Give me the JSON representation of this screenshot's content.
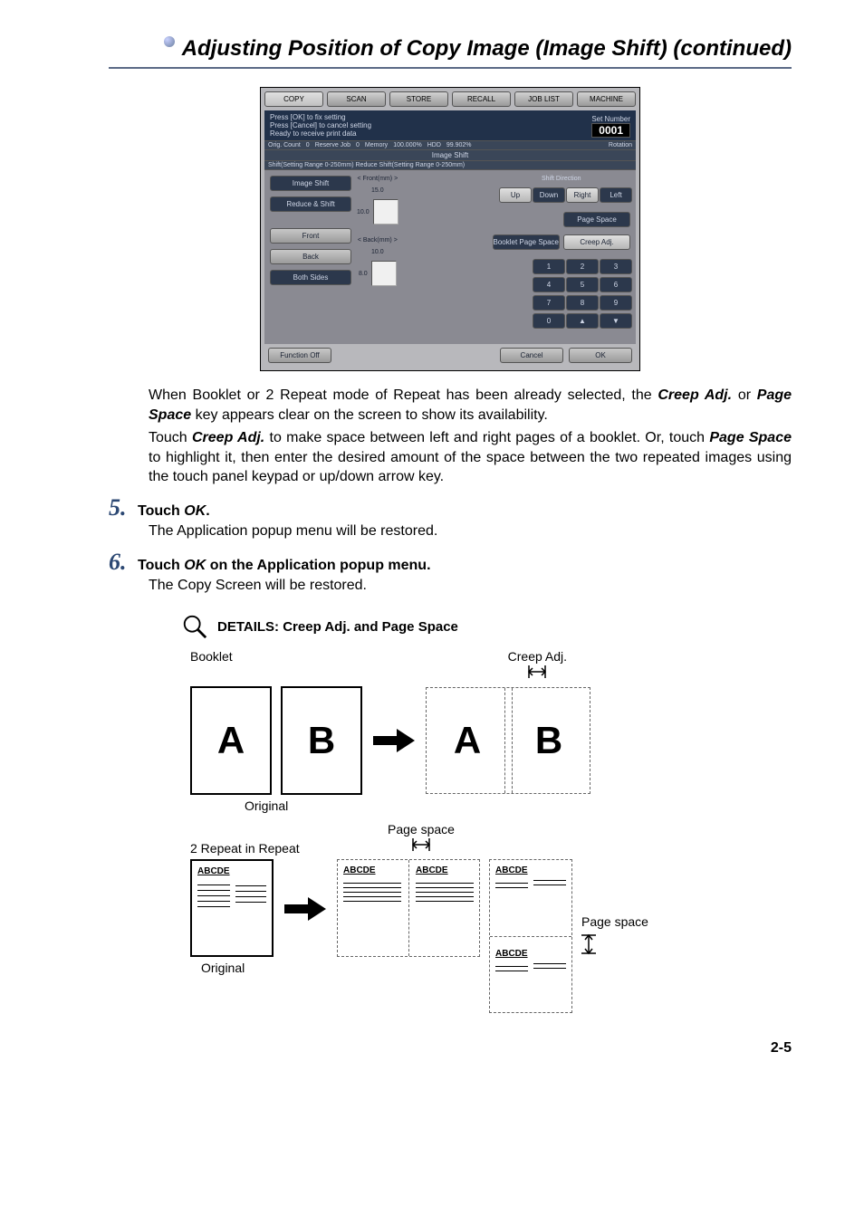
{
  "title": "Adjusting Position of Copy Image (Image Shift) (continued)",
  "panel": {
    "tabs": [
      "COPY",
      "SCAN",
      "STORE",
      "RECALL",
      "JOB LIST",
      "MACHINE"
    ],
    "msg1": "Press [OK] to fix setting",
    "msg2": "Press [Cancel] to cancel setting",
    "msg3": "Ready to receive print data",
    "setnum_label": "Set Number",
    "setnum_value": "0001",
    "status": {
      "orig_count": "Orig. Count",
      "orig_val": "0",
      "reserve": "Reserve Job",
      "reserve_val": "0",
      "memory": "Memory",
      "memory_val": "100.000%",
      "hdd": "HDD",
      "hdd_val": "99.902%",
      "rotation": "Rotation"
    },
    "heading": "Image Shift",
    "subheading": "Shift(Setting Range 0-250mm)  Reduce Shift(Setting Range 0-250mm)",
    "left_buttons": {
      "image_shift": "Image Shift",
      "reduce_shift": "Reduce & Shift",
      "front": "Front",
      "back": "Back",
      "both_sides": "Both Sides"
    },
    "center": {
      "front_label": "< Front(mm) >",
      "front_top": "15.0",
      "front_left": "10.0",
      "back_label": "< Back(mm) >",
      "back_top": "10.0",
      "back_left": "8.0"
    },
    "right": {
      "shift_dir": "Shift Direction",
      "dirs": [
        "Up",
        "Down",
        "Right",
        "Left"
      ],
      "page_space": "Page Space",
      "booklet_ps": "Booklet Page Space",
      "creep_adj": "Creep Adj.",
      "numpad": [
        "1",
        "2",
        "3",
        "4",
        "5",
        "6",
        "7",
        "8",
        "9",
        "0",
        "▲",
        "▼"
      ]
    },
    "function_off": "Function Off",
    "cancel": "Cancel",
    "ok": "OK"
  },
  "para1_prefix": "When Booklet or 2 Repeat mode of Repeat has been already selected, the ",
  "para1_creep": "Creep Adj.",
  "para1_or": " or ",
  "para1_ps": "Page Space",
  "para1_suffix": " key appears clear on the screen to show its availability.",
  "para2_prefix": "Touch ",
  "para2_creep": "Creep Adj.",
  "para2_mid": " to make space between left and right pages of a booklet. Or, touch ",
  "para2_ps": "Page Space",
  "para2_suffix": " to highlight it, then enter the desired amount of the space between the two repeated images using the touch panel keypad or up/down arrow key.",
  "step5_num": "5.",
  "step5_head_a": "Touch ",
  "step5_head_b": "OK",
  "step5_head_c": ".",
  "step5_body": "The Application popup menu will be restored.",
  "step6_num": "6.",
  "step6_head_a": "Touch ",
  "step6_head_b": "OK",
  "step6_head_c": " on the Application popup menu.",
  "step6_body": "The Copy Screen will be restored.",
  "details_title": "DETAILS: Creep Adj. and Page Space",
  "diag1": {
    "booklet": "Booklet",
    "creep": "Creep Adj.",
    "A": "A",
    "B": "B",
    "original": "Original"
  },
  "diag2": {
    "page_space": "Page space",
    "repeat": "2 Repeat in Repeat",
    "abcde": "ABCDE",
    "original": "Original",
    "page_space_side": "Page space"
  },
  "page_num": "2-5"
}
